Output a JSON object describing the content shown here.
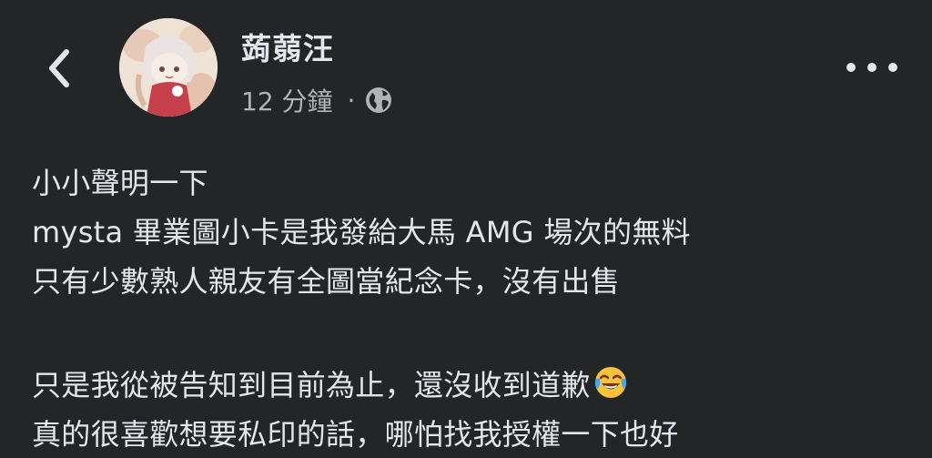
{
  "header": {
    "author": "蒟蒻汪",
    "time": "12 分鐘",
    "separator": "·",
    "icons": {
      "back": "chevron-left-icon",
      "privacy": "globe-icon",
      "more": "more-dots-icon"
    }
  },
  "post": {
    "lines": [
      "小小聲明一下",
      "mysta 畢業圖小卡是我發給大馬 AMG 場次的無料",
      "只有少數熟人親友有全圖當紀念卡，沒有出售",
      "",
      "只是我從被告知到目前為止，還沒收到道歉",
      "真的很喜歡想要私印的話，哪怕找我授權一下也好"
    ],
    "emoji": "tears-of-joy-emoji-icon"
  },
  "colors": {
    "background": "#242527",
    "text_primary": "#e4e6eb",
    "text_secondary": "#b0b3b8"
  }
}
